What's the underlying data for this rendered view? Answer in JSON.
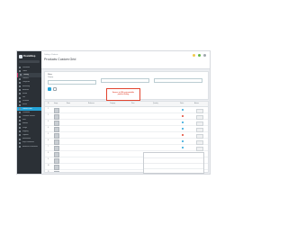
{
  "app": {
    "logo_text": "PrestaShop"
  },
  "header": {
    "breadcrumb": "Catalog > Products",
    "title": "Products Custom Grid",
    "link": ""
  },
  "sidebar": {
    "items": [
      {
        "label": "Dashboard"
      },
      {
        "label": "Orders"
      },
      {
        "label": "Catalog"
      },
      {
        "label": "Products"
      },
      {
        "label": "Categories"
      },
      {
        "label": "Monitoring"
      },
      {
        "label": "Attributes"
      },
      {
        "label": "Brands"
      },
      {
        "label": "Files"
      },
      {
        "label": "Discounts"
      },
      {
        "label": "Stocks"
      },
      {
        "label": "Products Grid"
      },
      {
        "label": "Customers"
      },
      {
        "label": "Customer Service"
      },
      {
        "label": "Stats"
      },
      {
        "label": "Modules"
      },
      {
        "label": "Design"
      },
      {
        "label": "Shipping"
      },
      {
        "label": "Payment"
      },
      {
        "label": "International"
      },
      {
        "label": "Shop Parameters"
      },
      {
        "label": "Advanced Parameters"
      }
    ]
  },
  "filters": {
    "title": "Filters",
    "groups": [
      {
        "label": "Category",
        "value": ""
      },
      {
        "label": "",
        "value": ""
      },
      {
        "label": "",
        "value": ""
      }
    ]
  },
  "notice": {
    "line1": "Access to 100 customizable",
    "line2": "product listing"
  },
  "table": {
    "columns": [
      "ID",
      "Image",
      "Name",
      "Reference",
      "Category",
      "Price",
      "Quantity",
      "Status",
      "Actions"
    ],
    "rows": [
      {
        "id": "1",
        "name": "",
        "ref": "",
        "cat": "",
        "price": "",
        "qty": ""
      },
      {
        "id": "2",
        "name": "",
        "ref": "",
        "cat": "",
        "price": "",
        "qty": ""
      },
      {
        "id": "3",
        "name": "",
        "ref": "",
        "cat": "",
        "price": "",
        "qty": ""
      },
      {
        "id": "4",
        "name": "",
        "ref": "",
        "cat": "",
        "price": "",
        "qty": ""
      },
      {
        "id": "5",
        "name": "",
        "ref": "",
        "cat": "",
        "price": "",
        "qty": ""
      },
      {
        "id": "6",
        "name": "",
        "ref": "",
        "cat": "",
        "price": "",
        "qty": ""
      },
      {
        "id": "7",
        "name": "",
        "ref": "",
        "cat": "",
        "price": "",
        "qty": ""
      },
      {
        "id": "8",
        "name": "",
        "ref": "",
        "cat": "",
        "price": "",
        "qty": ""
      },
      {
        "id": "9",
        "name": "",
        "ref": "",
        "cat": "",
        "price": "",
        "qty": ""
      },
      {
        "id": "10",
        "name": "",
        "ref": "",
        "cat": "",
        "price": "",
        "qty": ""
      },
      {
        "id": "11",
        "name": "",
        "ref": "",
        "cat": "",
        "price": "",
        "qty": ""
      },
      {
        "id": "12",
        "name": "",
        "ref": "",
        "cat": "",
        "price": "",
        "qty": ""
      }
    ]
  },
  "colors": {
    "sidebar_bg": "#2b3036",
    "accent": "#25a4d8",
    "notice_red": "#e2432e",
    "status_on": "#25a4d8",
    "status_off": "#e2432e"
  },
  "icons": {
    "header": [
      "notification-icon",
      "shop-icon",
      "user-icon"
    ],
    "logo": "logo-icon"
  }
}
